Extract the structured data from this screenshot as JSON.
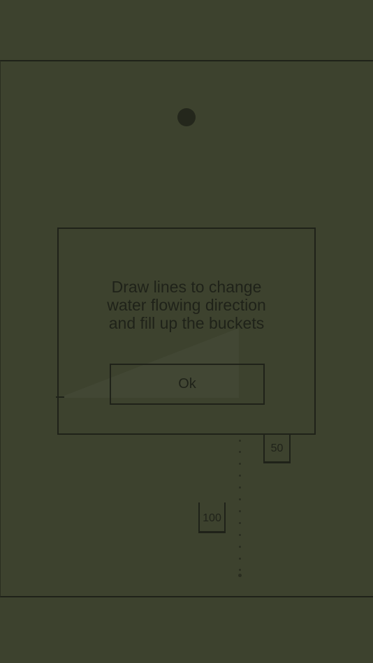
{
  "dialog": {
    "line1": "Draw lines to change",
    "line2": "water flowing direction",
    "line3": "and fill up the buckets",
    "ok_label": "Ok"
  },
  "buckets": [
    {
      "label": "50"
    },
    {
      "label": "100"
    }
  ],
  "colors": {
    "background": "#3d422e",
    "lines": "#1f2219"
  }
}
